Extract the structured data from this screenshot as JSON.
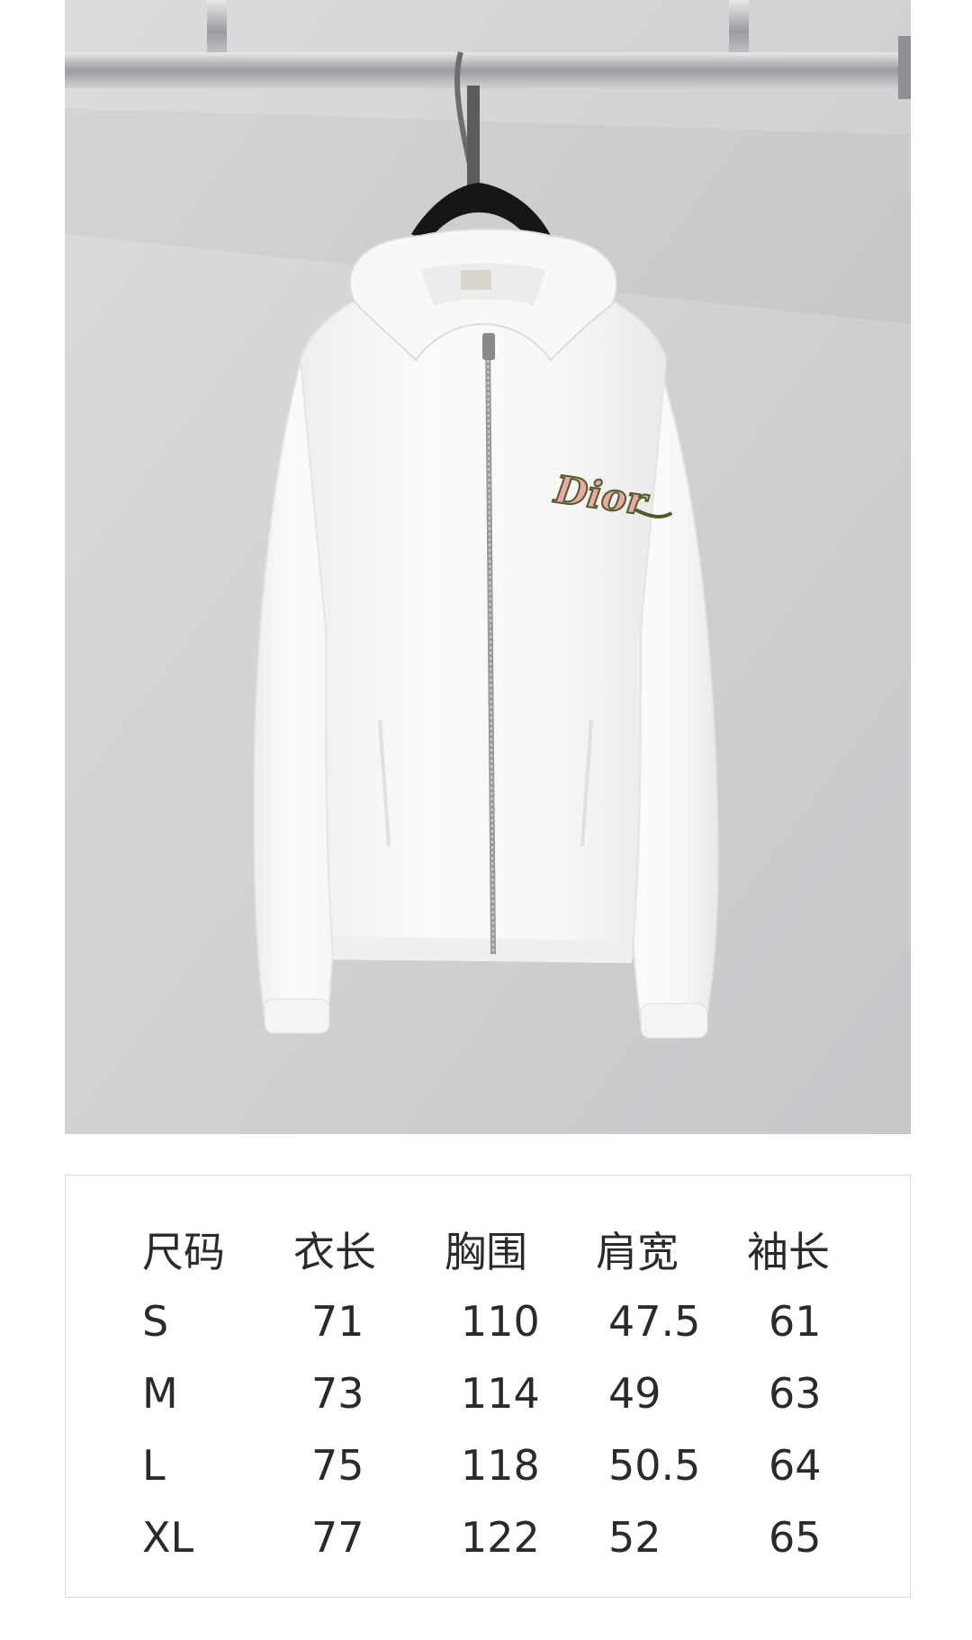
{
  "size_chart": {
    "headers": [
      "尺码",
      "衣长",
      "胸围",
      "肩宽",
      "袖长"
    ],
    "rows": [
      [
        "S",
        "71",
        "110",
        "47.5",
        "61"
      ],
      [
        "M",
        "73",
        "114",
        "49",
        "63"
      ],
      [
        "L",
        "75",
        "118",
        "50.5",
        "64"
      ],
      [
        "XL",
        "77",
        "122",
        "52",
        "65"
      ]
    ]
  },
  "product_photo": {
    "logo_text": "Dior",
    "colors": {
      "background_wall": "#d0d0d3",
      "jacket": "#f6f6f4",
      "hanger": "#1a1a1a",
      "rail": "#b8b8ba",
      "logo_pink": "#e8a9a6",
      "logo_green": "#4d5a2a"
    }
  }
}
